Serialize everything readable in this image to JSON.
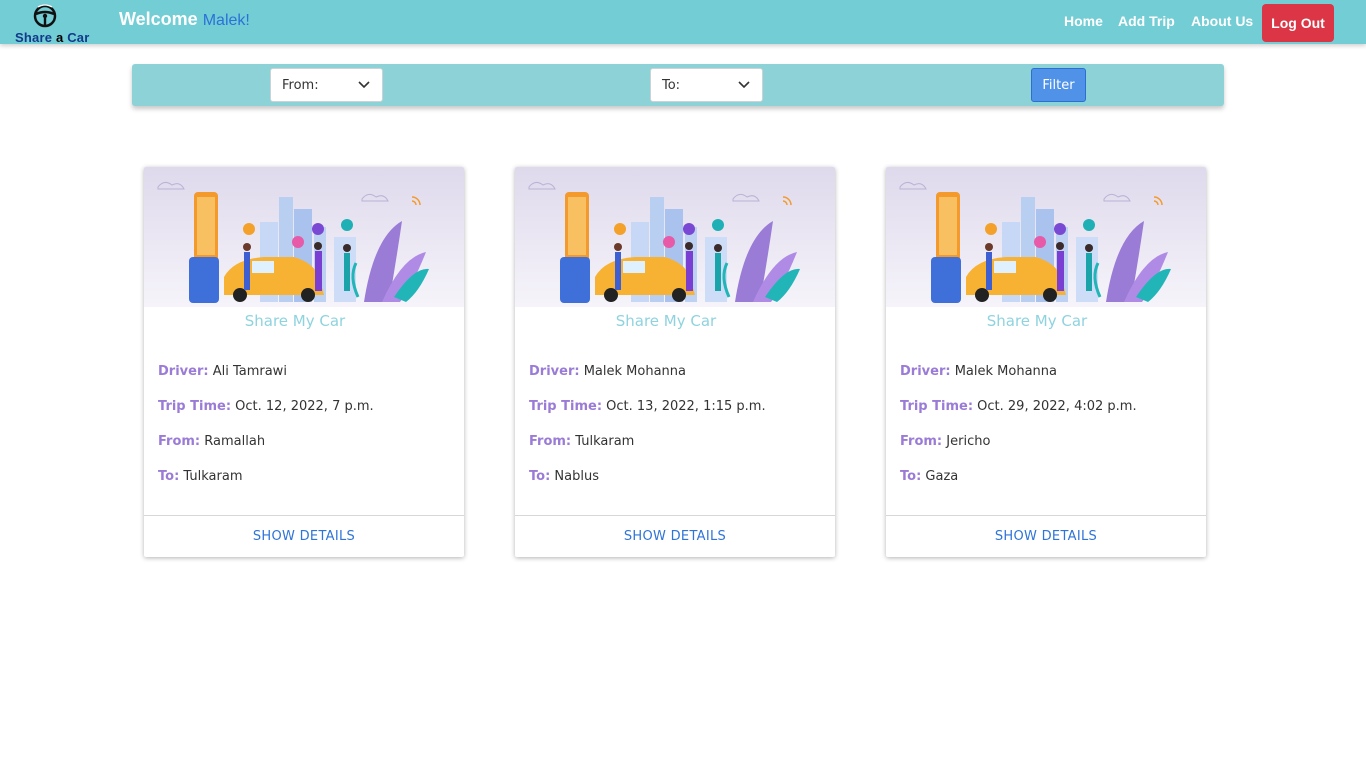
{
  "brand": {
    "logo_text_1": "Share",
    "logo_text_2": "a",
    "logo_text_3": "Car"
  },
  "header": {
    "welcome": "Welcome",
    "username": "Malek!"
  },
  "nav": {
    "home": "Home",
    "add_trip": "Add Trip",
    "about": "About Us",
    "logout": "Log Out"
  },
  "filter": {
    "from_label": "From:",
    "to_label": "To:",
    "button": "Filter"
  },
  "labels": {
    "driver": "Driver:",
    "trip_time": "Trip Time:",
    "from": "From:",
    "to": "To:",
    "show_details": "SHOW DETAILS",
    "card_title": "Share My Car"
  },
  "trips": [
    {
      "driver": "Ali Tamrawi",
      "time": "Oct. 12, 2022, 7 p.m.",
      "from": "Ramallah",
      "to": "Tulkaram"
    },
    {
      "driver": "Malek Mohanna",
      "time": "Oct. 13, 2022, 1:15 p.m.",
      "from": "Tulkaram",
      "to": "Nablus"
    },
    {
      "driver": "Malek Mohanna",
      "time": "Oct. 29, 2022, 4:02 p.m.",
      "from": "Jericho",
      "to": "Gaza"
    }
  ],
  "colors": {
    "navbar": "#73cdd5",
    "filterbar": "#8cd2d6",
    "logout": "#dc3545",
    "label": "#9a7bd6",
    "link": "#2f74d8"
  }
}
